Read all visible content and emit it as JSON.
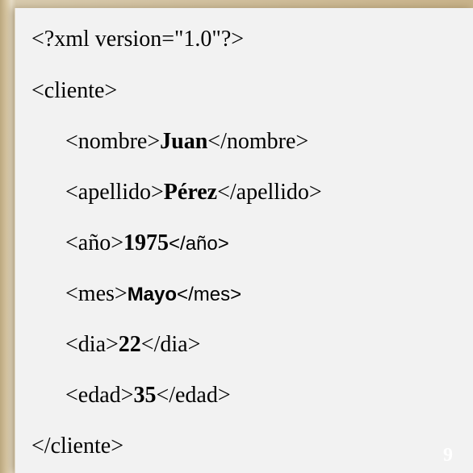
{
  "xml_lines": {
    "decl": "<?xml version=\"1.0\"?>",
    "cliente_open": "<cliente>",
    "nombre": {
      "open": "<nombre>",
      "value": "Juan",
      "close": "</nombre>"
    },
    "apellido": {
      "open": "<apellido>",
      "value": "Pérez",
      "close": "</apellido>"
    },
    "anio": {
      "open": "<año>",
      "value": "1975",
      "close": "</año>"
    },
    "mes": {
      "open": "<mes>",
      "value": "Mayo",
      "close": "</mes>"
    },
    "dia": {
      "open": "<dia>",
      "value": "22",
      "close": "</dia>"
    },
    "edad": {
      "open": "<edad>",
      "value": "35",
      "close": "</edad>"
    },
    "cliente_close": "</cliente>"
  },
  "page_number": "9"
}
